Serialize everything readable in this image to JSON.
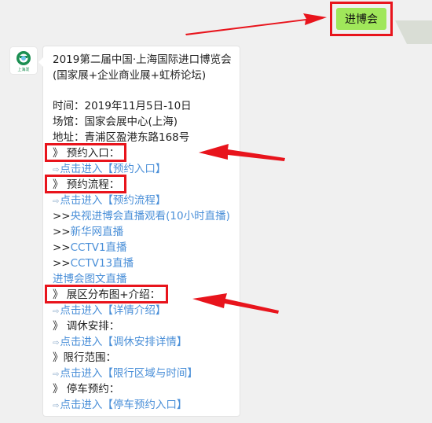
{
  "sent_message": "进博会",
  "avatar_caption": "上海发",
  "card": {
    "title_line1": "2019第二届中国·上海国际进口博览会",
    "title_line2": "(国家展+企业商业展+虹桥论坛)",
    "time": "时间：2019年11月5日-10日",
    "venue": "场馆：国家会展中心(上海)",
    "address": "地址：青浦区盈港东路168号",
    "sections": {
      "reservation_entry": "》 预约入口：",
      "reservation_entry_link": "点击进入【预约入口】",
      "reservation_flow": "》 预约流程：",
      "reservation_flow_link": "点击进入【预约流程】",
      "cctv_live_prefix": ">>",
      "cctv_live": "央视进博会直播观看(10小时直播)",
      "xinhua_prefix": ">>",
      "xinhua": "新华网直播",
      "cctv1_prefix": ">>",
      "cctv1": "CCTV1直播",
      "cctv13_prefix": ">>",
      "cctv13": "CCTV13直播",
      "photo_live": "进博会图文直播",
      "hall_map": "》 展区分布图+介绍：",
      "hall_map_link": "点击进入【详情介绍】",
      "holiday": "》 调休安排：",
      "holiday_link": "点击进入【调休安排详情】",
      "restriction": "》限行范围：",
      "restriction_link": "点击进入【限行区域与时间】",
      "parking": "》 停车预约：",
      "parking_link": "点击进入【停车预约入口】"
    },
    "link_icon": "⇨"
  },
  "colors": {
    "accent_red": "#e8141c",
    "bubble_green": "#a0e75a",
    "link_blue": "#4a8fd8"
  }
}
